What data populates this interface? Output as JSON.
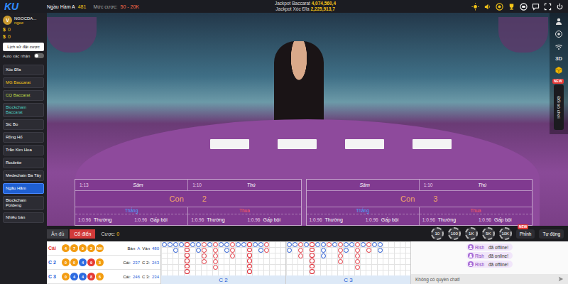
{
  "topbar": {
    "logo": "KU",
    "table_name": "Ngầu Hầm A",
    "round": "481",
    "bet_label": "Mức cược:",
    "bet_range": "50 - 20K",
    "jackpots": [
      {
        "label": "Jackpot Baccarat",
        "value": "4,074,560,4"
      },
      {
        "label": "Jackpot Xóc Đĩa",
        "value": "2,225,913,7"
      }
    ]
  },
  "user": {
    "avatar": "V",
    "name": "NGOCDA...",
    "subname": "ngoc",
    "balances": [
      {
        "icon": "$",
        "value": "0"
      },
      {
        "icon": "$",
        "value": "0"
      }
    ],
    "history_button": "Lịch sử đặt cược",
    "auto_confirm": {
      "label": "Auto xác nhận",
      "on": false
    }
  },
  "games": [
    {
      "label": "Xóc Đĩa",
      "color": "#ffffff",
      "selected": false
    },
    {
      "label": "MG Baccarat",
      "color": "#f5c518",
      "selected": false
    },
    {
      "label": "CQ Baccarat",
      "color": "#c8e04a",
      "selected": false
    },
    {
      "label": "Blockchain Baccarat",
      "color": "#4fd1c5",
      "selected": false
    },
    {
      "label": "Sic Bo",
      "color": "#ffffff",
      "selected": false
    },
    {
      "label": "Rồng Hổ",
      "color": "#ffffff",
      "selected": false
    },
    {
      "label": "Trần Kim Hoa",
      "color": "#ffffff",
      "selected": false
    },
    {
      "label": "Roulette",
      "color": "#ffffff",
      "selected": false
    },
    {
      "label": "Medechain Ba Tây",
      "color": "#ffffff",
      "selected": false
    },
    {
      "label": "Ngầu Hầm",
      "color": "#ffffff",
      "selected": true
    },
    {
      "label": "Blockchain Poldeng",
      "color": "#ffffff",
      "selected": false
    },
    {
      "label": "Nhiều bàn",
      "color": "#ffffff",
      "selected": false
    }
  ],
  "side_tools": {
    "label_3d": "3D",
    "switch_game": {
      "label": "Đổi trò chơi",
      "badge": "NEW"
    }
  },
  "board": [
    {
      "title": "Con",
      "number": "2",
      "specials": [
        {
          "odds": "1:13",
          "label": "Sâm"
        },
        {
          "odds": "1:10",
          "label": "Thú"
        }
      ],
      "columns": [
        {
          "header": "Thắng",
          "color": "#4aa3ff",
          "bets": [
            {
              "odds": "1:0.96",
              "label": "Thường"
            },
            {
              "odds": "1:0.96",
              "label": "Gấp bội"
            }
          ]
        },
        {
          "header": "Thua",
          "color": "#ff5a5a",
          "bets": [
            {
              "odds": "1:0.96",
              "label": "Thường"
            },
            {
              "odds": "1:0.96",
              "label": "Gấp bội"
            }
          ]
        }
      ]
    },
    {
      "title": "Con",
      "number": "3",
      "specials": [
        {
          "odds": "",
          "label": "Sâm"
        },
        {
          "odds": "1:10",
          "label": "Thú"
        }
      ],
      "columns": [
        {
          "header": "Thắng",
          "color": "#4aa3ff",
          "bets": [
            {
              "odds": "1:0.96",
              "label": "Thường"
            },
            {
              "odds": "1:0.96",
              "label": "Gấp bội"
            }
          ]
        },
        {
          "header": "Thua",
          "color": "#ff5a5a",
          "bets": [
            {
              "odds": "1:0.96",
              "label": "Thường"
            },
            {
              "odds": "1:0.96",
              "label": "Gấp bội"
            }
          ]
        }
      ]
    }
  ],
  "modes": [
    {
      "label": "Ăn đủ",
      "selected": false
    },
    {
      "label": "Cổ điển",
      "selected": true
    }
  ],
  "bet": {
    "label": "Cược:",
    "value": "0"
  },
  "chips": [
    "10",
    "100",
    "1K",
    "5K",
    "10K"
  ],
  "chip_buttons": [
    {
      "label": "Phỉnh",
      "badge": "NEW"
    },
    {
      "label": "Tự động",
      "badge": ""
    }
  ],
  "roadmap": [
    {
      "label": "Cái",
      "color": "#e53935",
      "beads": [
        {
          "text": "4",
          "color": "#f39c12"
        },
        {
          "text": "7",
          "color": "#f39c12"
        },
        {
          "text": "9",
          "color": "#f39c12"
        },
        {
          "text": "3",
          "color": "#f39c12"
        },
        {
          "text": "NH",
          "color": "#f39c12"
        }
      ],
      "info": [
        {
          "text": "Bàn",
          "accent": false
        },
        {
          "text": "A",
          "accent": true
        },
        {
          "text": "Ván",
          "accent": false
        },
        {
          "text": "480",
          "accent": true
        }
      ]
    },
    {
      "label": "C 2",
      "color": "#1e5ad6",
      "beads": [
        {
          "text": "0",
          "color": "#f39c12"
        },
        {
          "text": "0",
          "color": "#f39c12"
        },
        {
          "text": "4",
          "color": "#2e6be0"
        },
        {
          "text": "9",
          "color": "#e53935"
        },
        {
          "text": "3",
          "color": "#f39c12"
        }
      ],
      "info": [
        {
          "text": "Cái:",
          "accent": false
        },
        {
          "text": "237",
          "accent": true
        },
        {
          "text": "C 2:",
          "accent": false
        },
        {
          "text": "243",
          "accent": true
        }
      ]
    },
    {
      "label": "C 3",
      "color": "#1e5ad6",
      "beads": [
        {
          "text": "0",
          "color": "#f39c12"
        },
        {
          "text": "4",
          "color": "#2e6be0"
        },
        {
          "text": "4",
          "color": "#2e6be0"
        },
        {
          "text": "8",
          "color": "#e53935"
        },
        {
          "text": "6",
          "color": "#f39c12"
        }
      ],
      "info": [
        {
          "text": "Cái:",
          "accent": false
        },
        {
          "text": "246",
          "accent": true
        },
        {
          "text": "C 3:",
          "accent": false
        },
        {
          "text": "234",
          "accent": true
        }
      ]
    }
  ],
  "roads": [
    {
      "label": "C 2",
      "columns": [
        [
          "#2255d0"
        ],
        [
          "#2255d0"
        ],
        [
          "#2255d0",
          "#2255d0"
        ],
        [
          "#2255d0"
        ],
        [
          "#e0303a",
          "#e0303a",
          "#e0303a",
          "#e0303a",
          "#e0303a",
          "#e0303a"
        ],
        [
          "#2255d0"
        ],
        [
          "#2255d0",
          "#2255d0"
        ],
        [
          "#e0303a",
          "#e0303a",
          "#e0303a",
          "#e0303a"
        ],
        [
          "#2255d0"
        ],
        [
          "#e0303a",
          "#e0303a",
          "#e0303a",
          "#e0303a",
          "#e0303a"
        ],
        [
          "#2255d0"
        ],
        [
          "#2255d0",
          "#2255d0"
        ],
        [
          "#e0303a",
          "#e0303a",
          "#e0303a"
        ],
        [
          "#2255d0"
        ],
        [
          "#2255d0"
        ],
        [
          "#e0303a",
          "#e0303a",
          "#e0303a",
          "#e0303a",
          "#e0303a",
          "#e0303a"
        ],
        [
          "#2255d0"
        ],
        [
          "#2255d0",
          "#2255d0"
        ],
        [
          "#e0303a",
          "#e0303a"
        ]
      ]
    },
    {
      "label": "C 3",
      "columns": [
        [
          "#2255d0",
          "#2255d0"
        ],
        [
          "#2255d0"
        ],
        [
          "#e0303a",
          "#e0303a",
          "#e0303a"
        ],
        [
          "#2255d0"
        ],
        [
          "#e0303a",
          "#e0303a",
          "#e0303a",
          "#e0303a",
          "#e0303a",
          "#e0303a"
        ],
        [
          "#2255d0"
        ],
        [
          "#2255d0",
          "#2255d0",
          "#2255d0"
        ],
        [
          "#e0303a"
        ],
        [
          "#2255d0"
        ],
        [
          "#e0303a",
          "#e0303a",
          "#e0303a",
          "#e0303a"
        ],
        [
          "#2255d0",
          "#2255d0"
        ],
        [
          "#2255d0"
        ],
        [
          "#e0303a",
          "#e0303a",
          "#e0303a",
          "#e0303a",
          "#e0303a"
        ],
        [
          "#2255d0"
        ],
        [
          "#e0303a",
          "#e0303a"
        ],
        [
          "#2255d0"
        ],
        [
          "#2255d0",
          "#2255d0"
        ]
      ]
    }
  ],
  "chat": {
    "messages": [
      {
        "name": "Rish",
        "text": "đã offline!"
      },
      {
        "name": "Rish",
        "text": "đã online!"
      },
      {
        "name": "Rish",
        "text": "đã offline!"
      }
    ],
    "input_placeholder": "Không có quyền chat!"
  }
}
